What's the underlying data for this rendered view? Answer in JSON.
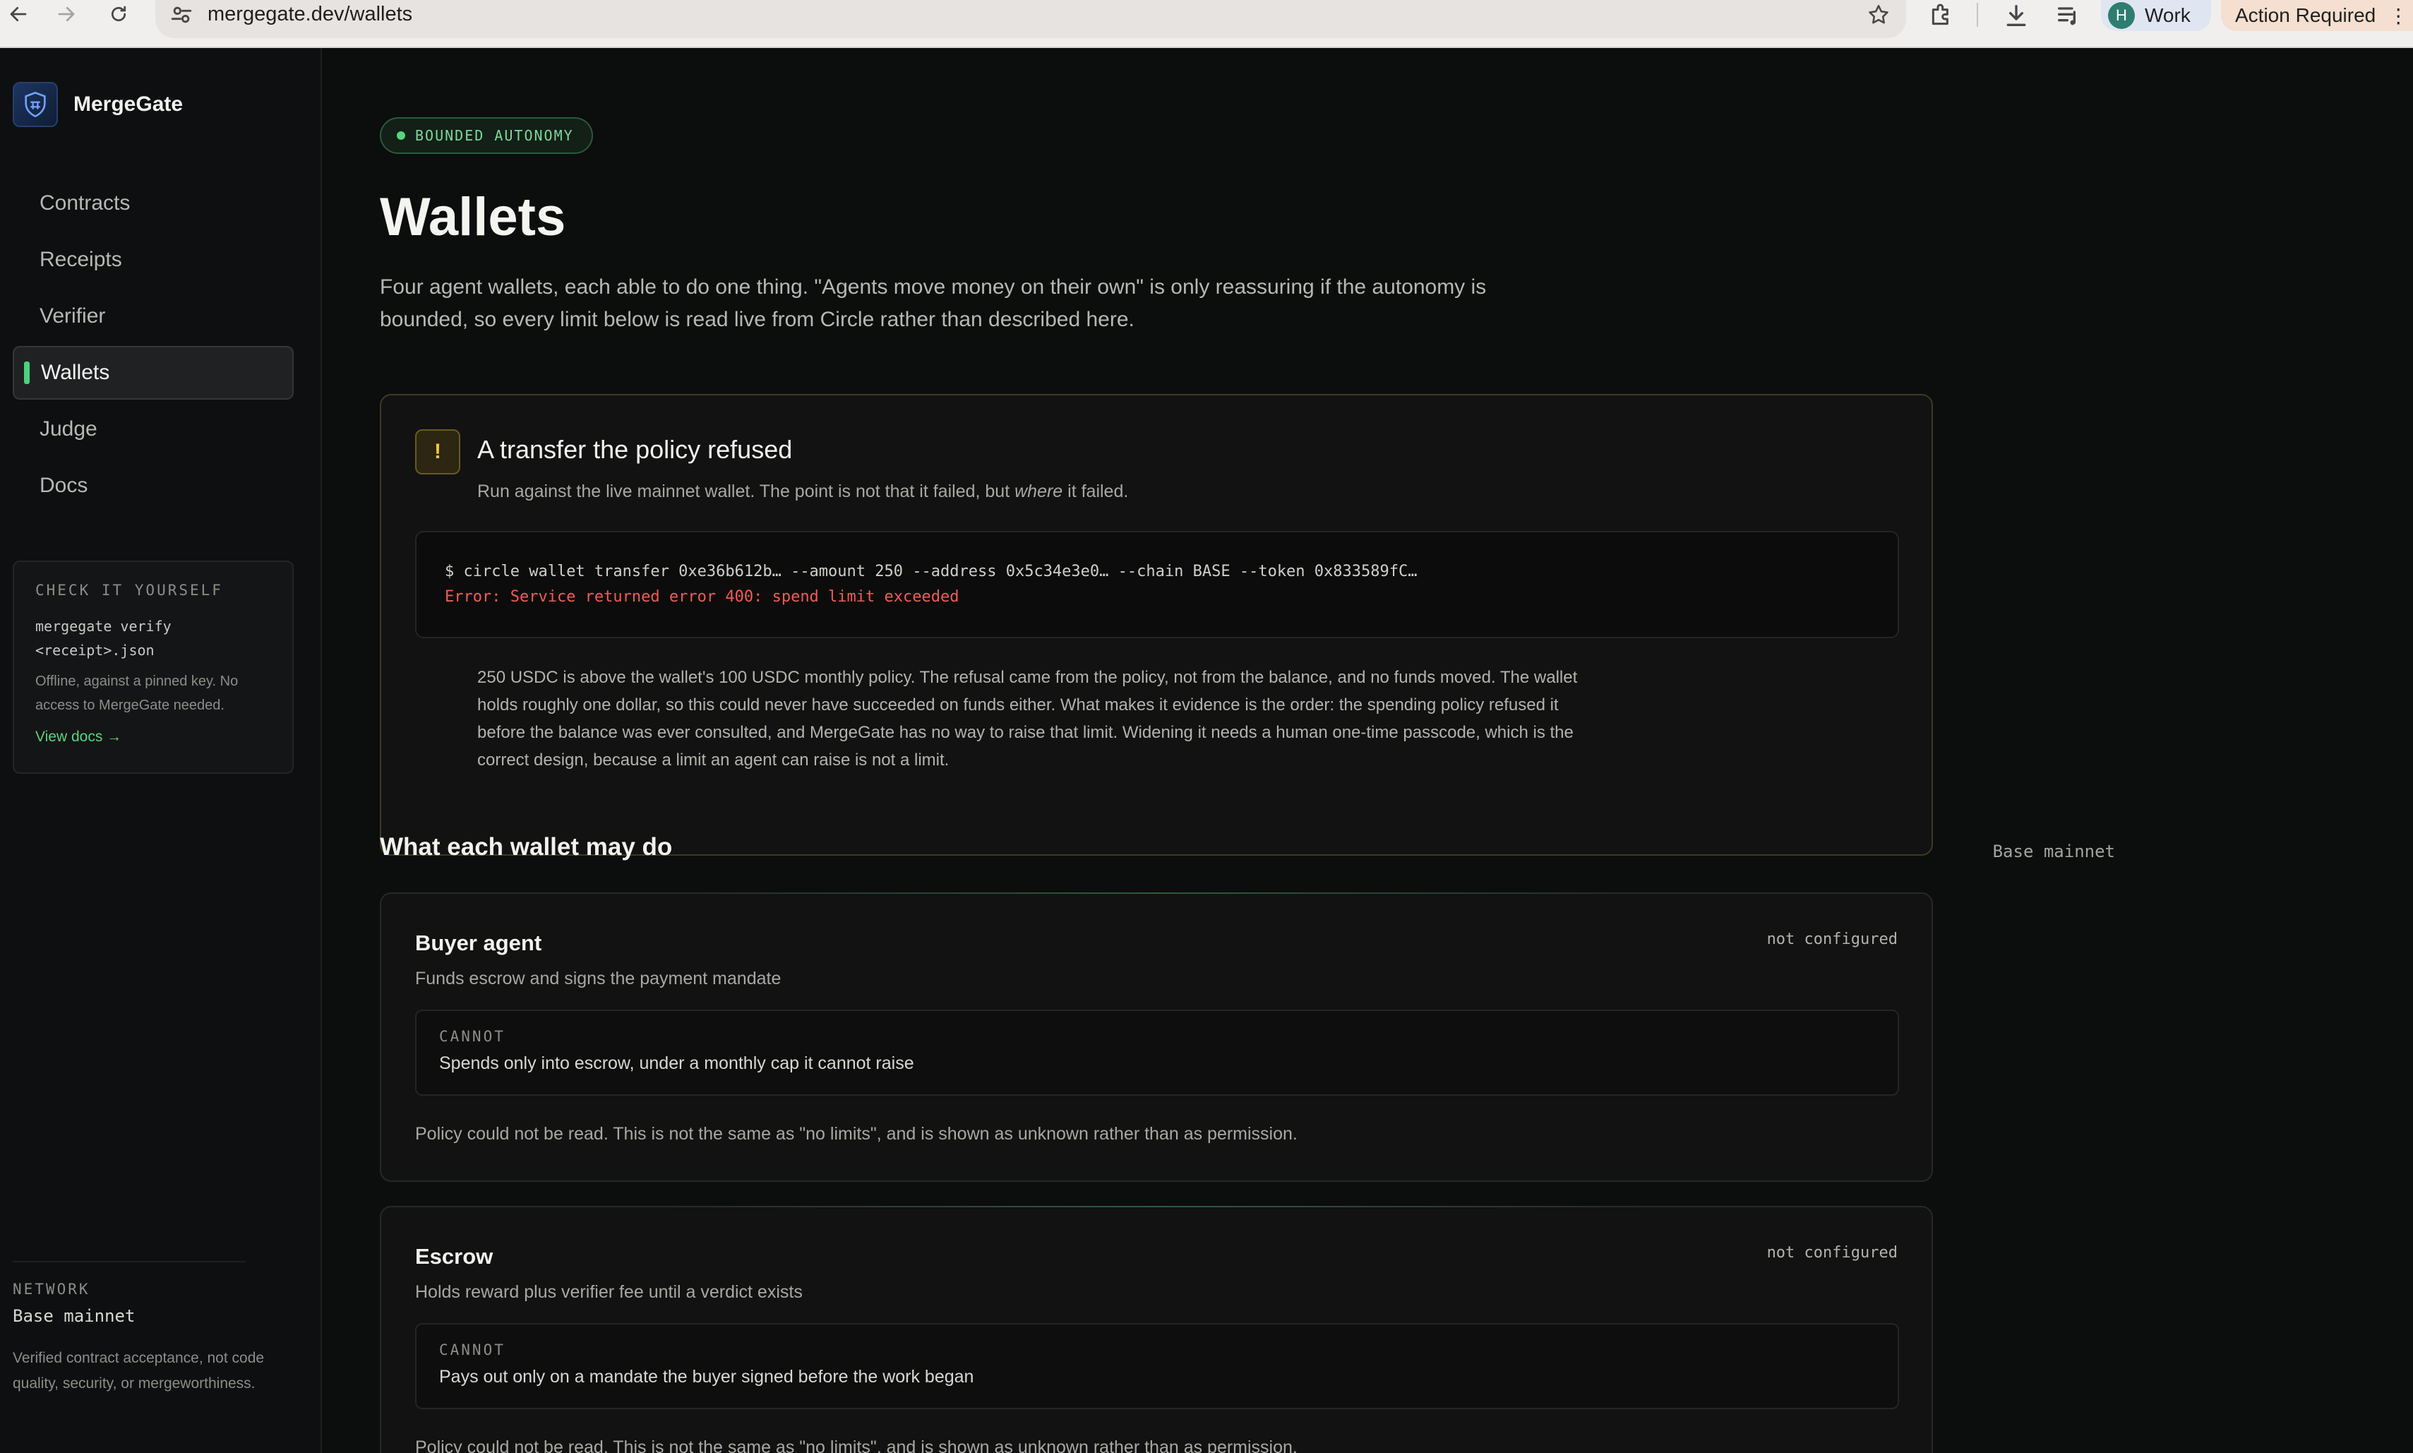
{
  "browser": {
    "url": "mergegate.dev/wallets",
    "profile_initial": "H",
    "profile_label": "Work",
    "action_label": "Action Required"
  },
  "sidebar": {
    "brand": "MergeGate",
    "items": [
      {
        "label": "Contracts",
        "active": false
      },
      {
        "label": "Receipts",
        "active": false
      },
      {
        "label": "Verifier",
        "active": false
      },
      {
        "label": "Wallets",
        "active": true
      },
      {
        "label": "Judge",
        "active": false
      },
      {
        "label": "Docs",
        "active": false
      }
    ],
    "check_card": {
      "heading": "CHECK IT YOURSELF",
      "command_line1": "mergegate verify",
      "command_line2": "<receipt>.json",
      "description": "Offline, against a pinned key. No access to MergeGate needed.",
      "link": "View docs →"
    },
    "network_label": "NETWORK",
    "network_value": "Base mainnet",
    "disclaimer": "Verified contract acceptance, not code quality, security, or mergeworthiness."
  },
  "main": {
    "badge": "BOUNDED AUTONOMY",
    "title": "Wallets",
    "description": "Four agent wallets, each able to do one thing. \"Agents move money on their own\" is only reassuring if the autonomy is bounded, so every limit below is read live from Circle rather than described here.",
    "refused": {
      "icon": "!",
      "title": "A transfer the policy refused",
      "sub_before": "Run against the live mainnet wallet. The point is not that it failed, but ",
      "sub_em": "where",
      "sub_after": " it failed.",
      "terminal_command": "$ circle wallet transfer 0xe36b612b… --amount 250 --address 0x5c34e3e0… --chain BASE --token 0x833589fC…",
      "terminal_error": "Error: Service returned error 400: spend limit exceeded",
      "body": "250 USDC is above the wallet's 100 USDC monthly policy. The refusal came from the policy, not from the balance, and no funds moved. The wallet holds roughly one dollar, so this could never have succeeded on funds either. What makes it evidence is the order: the spending policy refused it before the balance was ever consulted, and MergeGate has no way to raise that limit. Widening it needs a human one-time passcode, which is the correct design, because a limit an agent can raise is not a limit."
    },
    "section_title": "What each wallet may do",
    "section_meta": "Base mainnet",
    "wallets": [
      {
        "name": "Buyer agent",
        "status": "not configured",
        "description": "Funds escrow and signs the payment mandate",
        "cannot_label": "CANNOT",
        "cannot_text": "Spends only into escrow, under a monthly cap it cannot raise",
        "policy_note": "Policy could not be read. This is not the same as \"no limits\", and is shown as unknown rather than as permission."
      },
      {
        "name": "Escrow",
        "status": "not configured",
        "description": "Holds reward plus verifier fee until a verdict exists",
        "cannot_label": "CANNOT",
        "cannot_text": "Pays out only on a mandate the buyer signed before the work began",
        "policy_note": "Policy could not be read. This is not the same as \"no limits\", and is shown as unknown rather than as permission."
      }
    ]
  }
}
